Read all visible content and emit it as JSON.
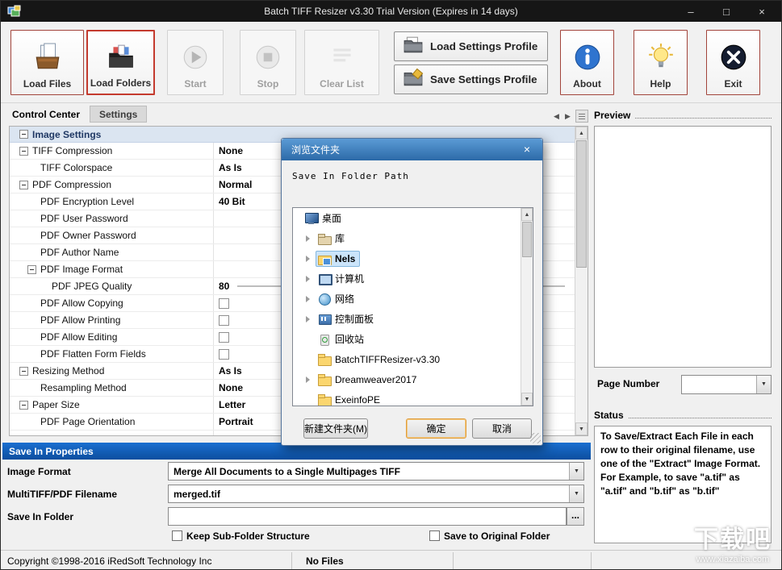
{
  "window": {
    "title": "Batch TIFF Resizer v3.30  Trial Version (Expires in 14 days)",
    "min": "–",
    "max": "□",
    "close": "×"
  },
  "toolbar": {
    "load_files": "Load Files",
    "load_folders": "Load Folders",
    "start": "Start",
    "stop": "Stop",
    "clear_list": "Clear List",
    "load_settings_profile": "Load Settings Profile",
    "save_settings_profile": "Save Settings Profile",
    "about": "About",
    "help": "Help",
    "exit": "Exit"
  },
  "tabs": {
    "control_center": "Control Center",
    "settings": "Settings"
  },
  "grid": {
    "header": "Image Settings",
    "rows": [
      {
        "label": "TIFF Compression",
        "value": "None",
        "cls": "lvl1 hasx"
      },
      {
        "label": "TIFF Colorspace",
        "value": "As Is",
        "cls": "lvl2"
      },
      {
        "label": "PDF Compression",
        "value": "Normal",
        "cls": "lvl1 hasx"
      },
      {
        "label": "PDF Encryption Level",
        "value": "40 Bit",
        "cls": "lvl2"
      },
      {
        "label": "PDF User Password",
        "value": "",
        "cls": "lvl2"
      },
      {
        "label": "PDF Owner Password",
        "value": "",
        "cls": "lvl2"
      },
      {
        "label": "PDF Author Name",
        "value": "",
        "cls": "lvl2"
      },
      {
        "label": "PDF Image Format",
        "value": "",
        "cls": "lvl2 hasx"
      },
      {
        "label": "PDF JPEG Quality",
        "value": "80",
        "cls": "lvl3 hasslider"
      },
      {
        "label": "PDF Allow Copying",
        "value": "",
        "cls": "lvl2 haschk"
      },
      {
        "label": "PDF Allow Printing",
        "value": "",
        "cls": "lvl2 haschk"
      },
      {
        "label": "PDF Allow Editing",
        "value": "",
        "cls": "lvl2 haschk"
      },
      {
        "label": "PDF Flatten Form Fields",
        "value": "",
        "cls": "lvl2 haschk"
      },
      {
        "label": "Resizing Method",
        "value": "As Is",
        "cls": "lvl1 hasx"
      },
      {
        "label": "Resampling Method",
        "value": "None",
        "cls": "lvl2"
      },
      {
        "label": "Paper Size",
        "value": "Letter",
        "cls": "lvl1 hasx"
      },
      {
        "label": "PDF Page Orientation",
        "value": "Portrait",
        "cls": "lvl2"
      },
      {
        "label": "",
        "value": "",
        "cls": "lvl2"
      }
    ]
  },
  "save_in": {
    "header": "Save In Properties",
    "image_format_label": "Image Format",
    "image_format_value": "Merge All Documents to a Single Multipages TIFF",
    "filename_label": "MultiTIFF/PDF Filename",
    "filename_value": "merged.tif",
    "folder_label": "Save In Folder",
    "folder_value": "",
    "browse_label": "...",
    "keep_subfolder_label": "Keep Sub-Folder Structure",
    "save_original_label": "Save to Original Folder"
  },
  "right_panel": {
    "preview_label": "Preview",
    "page_number_label": "Page Number",
    "status_label": "Status",
    "status_text": "To Save/Extract Each File in each row to their original filename, use one of the \"Extract\" Image Format. For Example, to save \"a.tif\" as \"a.tif\" and \"b.tif\" as \"b.tif\""
  },
  "statusbar": {
    "copyright": "Copyright ©1998-2016 iRedSoft Technology Inc",
    "files": "No Files"
  },
  "dialog": {
    "title": "浏览文件夹",
    "subtitle": "Save In Folder Path",
    "close": "×",
    "new_folder": "新建文件夹(M)",
    "ok": "确定",
    "cancel": "取消",
    "tree": [
      {
        "label": "桌面",
        "icon": "desktop-icon",
        "cls": "lvl0 ic-desktop"
      },
      {
        "label": "库",
        "icon": "libraries-icon",
        "cls": "lvl1 arrow ic-lib"
      },
      {
        "label": "Nels",
        "icon": "user-folder-icon",
        "cls": "lvl1 arrow sel ic-user"
      },
      {
        "label": "计算机",
        "icon": "computer-icon",
        "cls": "lvl1 arrow ic-computer"
      },
      {
        "label": "网络",
        "icon": "network-icon",
        "cls": "lvl1 arrow ic-network"
      },
      {
        "label": "控制面板",
        "icon": "control-panel-icon",
        "cls": "lvl1 arrow ic-cpanel"
      },
      {
        "label": "回收站",
        "icon": "recycle-bin-icon",
        "cls": "lvl1 ic-recycle"
      },
      {
        "label": "BatchTIFFResizer-v3.30",
        "icon": "folder-icon",
        "cls": "lvl1 ic-folder"
      },
      {
        "label": "Dreamweaver2017",
        "icon": "folder-icon",
        "cls": "lvl1 arrow ic-folder"
      },
      {
        "label": "ExeinfoPE",
        "icon": "folder-icon",
        "cls": "lvl1 ic-folder"
      }
    ]
  },
  "watermark": {
    "text": "下载吧",
    "sub": "www.xiazaiba.com"
  }
}
